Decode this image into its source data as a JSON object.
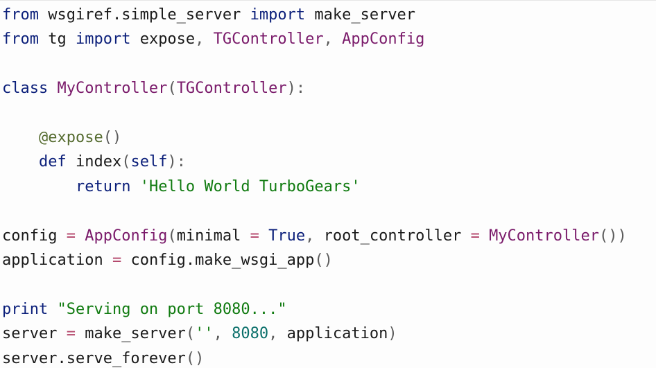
{
  "code_lines": [
    [
      {
        "t": "from",
        "c": "kw"
      },
      {
        "t": " wsgiref.simple_server ",
        "c": "plain"
      },
      {
        "t": "import",
        "c": "kw"
      },
      {
        "t": " make_server",
        "c": "plain"
      }
    ],
    [
      {
        "t": "from",
        "c": "kw"
      },
      {
        "t": " tg ",
        "c": "plain"
      },
      {
        "t": "import",
        "c": "kw"
      },
      {
        "t": " expose",
        "c": "plain"
      },
      {
        "t": ", ",
        "c": "punct"
      },
      {
        "t": "TGController",
        "c": "call"
      },
      {
        "t": ", ",
        "c": "punct"
      },
      {
        "t": "AppConfig",
        "c": "call"
      }
    ],
    [],
    [
      {
        "t": "class",
        "c": "kw"
      },
      {
        "t": " ",
        "c": "plain"
      },
      {
        "t": "MyController",
        "c": "call"
      },
      {
        "t": "(",
        "c": "punct"
      },
      {
        "t": "TGController",
        "c": "call"
      },
      {
        "t": "):",
        "c": "punct"
      }
    ],
    [],
    [
      {
        "t": "    ",
        "c": "plain"
      },
      {
        "t": "@expose",
        "c": "deco"
      },
      {
        "t": "()",
        "c": "punct"
      }
    ],
    [
      {
        "t": "    ",
        "c": "plain"
      },
      {
        "t": "def",
        "c": "kw"
      },
      {
        "t": " index",
        "c": "plain"
      },
      {
        "t": "(",
        "c": "punct"
      },
      {
        "t": "self",
        "c": "self"
      },
      {
        "t": "):",
        "c": "punct"
      }
    ],
    [
      {
        "t": "        ",
        "c": "plain"
      },
      {
        "t": "return",
        "c": "kw"
      },
      {
        "t": " ",
        "c": "plain"
      },
      {
        "t": "'Hello World TurboGears'",
        "c": "str"
      }
    ],
    [],
    [
      {
        "t": "config ",
        "c": "plain"
      },
      {
        "t": "=",
        "c": "op"
      },
      {
        "t": " ",
        "c": "plain"
      },
      {
        "t": "AppConfig",
        "c": "call"
      },
      {
        "t": "(",
        "c": "punct"
      },
      {
        "t": "minimal ",
        "c": "plain"
      },
      {
        "t": "=",
        "c": "op"
      },
      {
        "t": " ",
        "c": "plain"
      },
      {
        "t": "True",
        "c": "const"
      },
      {
        "t": ", ",
        "c": "punct"
      },
      {
        "t": "root_controller ",
        "c": "plain"
      },
      {
        "t": "=",
        "c": "op"
      },
      {
        "t": " ",
        "c": "plain"
      },
      {
        "t": "MyController",
        "c": "call"
      },
      {
        "t": "())",
        "c": "punct"
      }
    ],
    [
      {
        "t": "application ",
        "c": "plain"
      },
      {
        "t": "=",
        "c": "op"
      },
      {
        "t": " config.make_wsgi_app",
        "c": "plain"
      },
      {
        "t": "()",
        "c": "punct"
      }
    ],
    [],
    [
      {
        "t": "print",
        "c": "kw"
      },
      {
        "t": " ",
        "c": "plain"
      },
      {
        "t": "\"Serving on port 8080...\"",
        "c": "str"
      }
    ],
    [
      {
        "t": "server ",
        "c": "plain"
      },
      {
        "t": "=",
        "c": "op"
      },
      {
        "t": " make_server",
        "c": "plain"
      },
      {
        "t": "(",
        "c": "punct"
      },
      {
        "t": "''",
        "c": "str"
      },
      {
        "t": ", ",
        "c": "punct"
      },
      {
        "t": "8080",
        "c": "num"
      },
      {
        "t": ", ",
        "c": "punct"
      },
      {
        "t": "application",
        "c": "plain"
      },
      {
        "t": ")",
        "c": "punct"
      }
    ],
    [
      {
        "t": "server.serve_forever",
        "c": "plain"
      },
      {
        "t": "()",
        "c": "punct"
      }
    ]
  ]
}
